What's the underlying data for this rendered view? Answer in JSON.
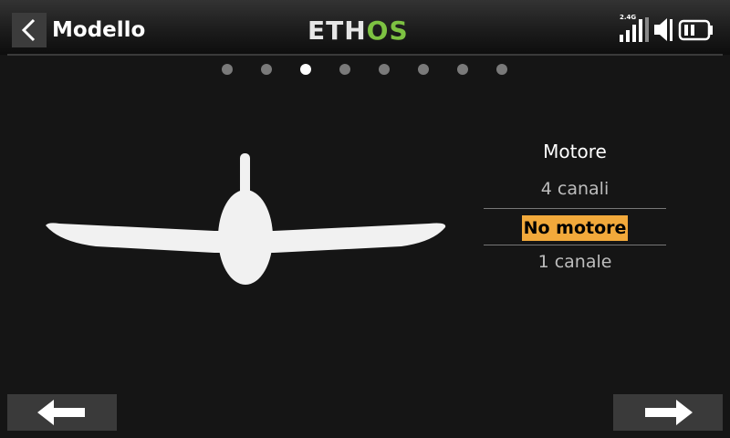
{
  "header": {
    "title": "Modello",
    "logo_part1": "ETH",
    "logo_part2": "OS",
    "rf_band": "2.4G"
  },
  "pager": {
    "count": 8,
    "active_index": 2
  },
  "model_type_icon": "plane-icon",
  "motor_selector": {
    "title": "Motore",
    "options": [
      "4 canali",
      "No motore",
      "1 canale"
    ],
    "selected": "No motore"
  },
  "nav": {
    "prev_icon": "arrow-left-icon",
    "next_icon": "arrow-right-icon"
  },
  "colors": {
    "accent": "#f2a93b",
    "logo_green": "#7dc242",
    "background": "#151515"
  }
}
